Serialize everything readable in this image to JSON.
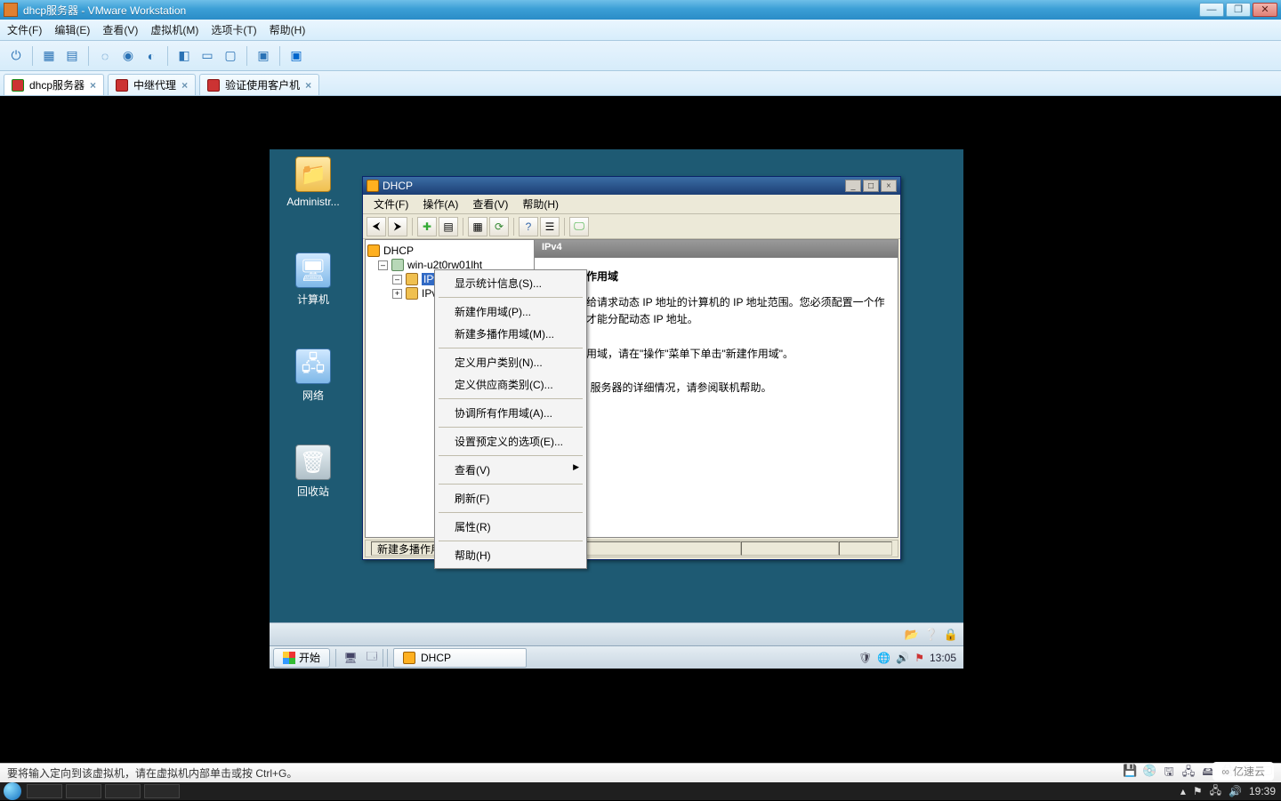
{
  "vmware": {
    "title": "dhcp服务器 - VMware Workstation",
    "menu": {
      "file": "文件(F)",
      "edit": "编辑(E)",
      "view": "查看(V)",
      "vm": "虚拟机(M)",
      "tabs": "选项卡(T)",
      "help": "帮助(H)"
    },
    "tabs": [
      {
        "label": "dhcp服务器",
        "active": true
      },
      {
        "label": "中继代理",
        "active": false
      },
      {
        "label": "验证使用客户机",
        "active": false
      }
    ],
    "status_text": "要将输入定向到该虚拟机，请在虚拟机内部单击或按 Ctrl+G。"
  },
  "guest": {
    "icons": {
      "admin": "Administr...",
      "computer": "计算机",
      "network": "网络",
      "recycle": "回收站"
    },
    "start": "开始",
    "task_dhcp": "DHCP",
    "clock": "13:05"
  },
  "mmc": {
    "title": "DHCP",
    "menu": {
      "file": "文件(F)",
      "action": "操作(A)",
      "view": "查看(V)",
      "help": "帮助(H)"
    },
    "tree": {
      "root": "DHCP",
      "server": "win-u2t0rw01lht",
      "ipv4": "IPv4",
      "ipv6": "IPv6"
    },
    "detail": {
      "header": "IPv4",
      "heading": "添加一个作用域",
      "p1": "是指分配给请求动态 IP 地址的计算机的 IP 地址范围。您必须配置一个作用域之后才能分配动态 IP 地址。",
      "p2": "一个新作用域，请在\"操作\"菜单下单击\"新建作用域\"。",
      "p3": "置 DHCP 服务器的详细情况，请参阅联机帮助。"
    },
    "status": "新建多播作用域"
  },
  "context_menu": {
    "items": [
      "显示统计信息(S)...",
      "-",
      "新建作用域(P)...",
      "新建多播作用域(M)...",
      "-",
      "定义用户类别(N)...",
      "定义供应商类别(C)...",
      "-",
      "协调所有作用域(A)...",
      "-",
      "设置预定义的选项(E)...",
      "-",
      "查看(V)",
      "-",
      "刷新(F)",
      "-",
      "属性(R)",
      "-",
      "帮助(H)"
    ],
    "submenu_index": 12
  },
  "watermark": "亿速云",
  "host_clock": "19:39"
}
